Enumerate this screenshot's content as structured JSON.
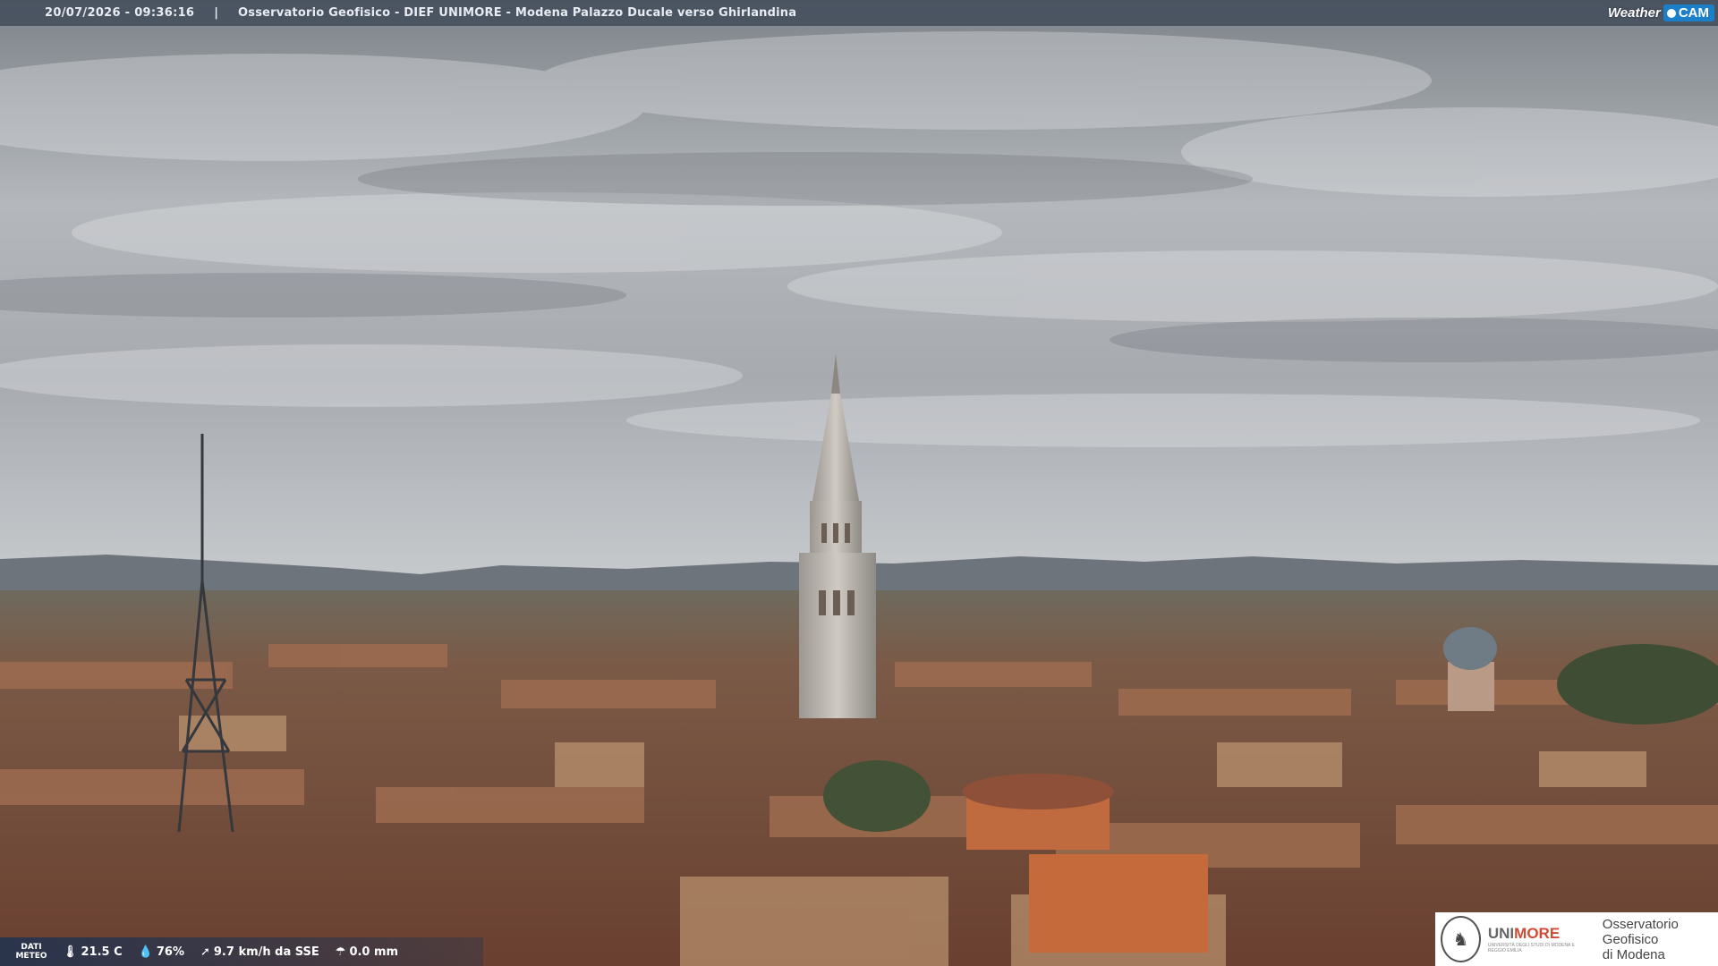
{
  "header": {
    "datetime": "20/07/2026 - 09:36:16",
    "separator": "|",
    "title": "Osservatorio Geofisico - DIEF UNIMORE - Modena Palazzo Ducale verso Ghirlandina"
  },
  "logo": {
    "weather": "Weather",
    "cam": "CAM"
  },
  "meteo": {
    "label_line1": "DATI",
    "label_line2": "METEO",
    "temperature": "21.5 C",
    "humidity": "76%",
    "wind": "9.7 km/h da SSE",
    "rain": "0.0 mm",
    "icons": [
      "thermometer-icon",
      "humidity-icon",
      "wind-icon",
      "rain-icon"
    ]
  },
  "institution": {
    "brand_part1": "UNI",
    "brand_part2": "MORE",
    "brand_sub": "UNIVERSITÀ DEGLI STUDI DI MODENA E REGGIO EMILIA",
    "name_line1": "Osservatorio Geofisico",
    "name_line2": "di Modena"
  },
  "colors": {
    "sky": "#9aa0a6",
    "roofs": "#8a5a40",
    "accent": "#d04a35",
    "bar": "#3c4656"
  }
}
